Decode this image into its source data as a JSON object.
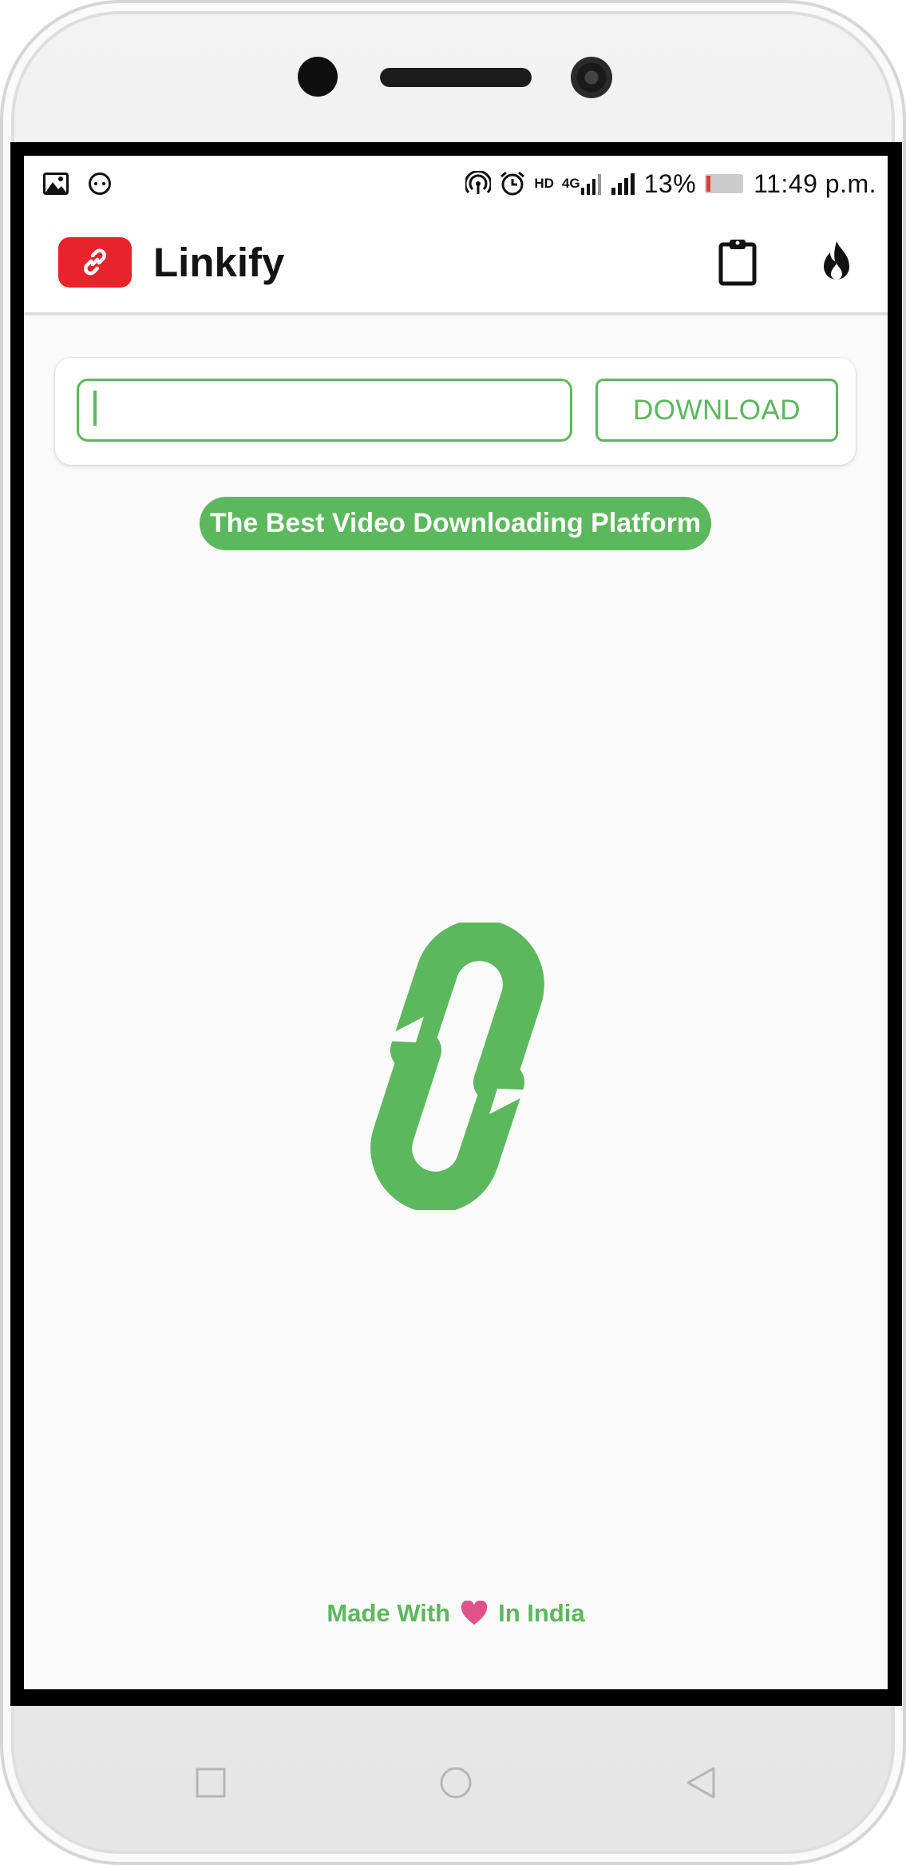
{
  "status_bar": {
    "battery_percent": "13%",
    "time": "11:49 p.m.",
    "network_type": "4G",
    "hd_badge": "HD",
    "icons": [
      "gallery-icon",
      "messenger-icon",
      "hotspot-icon",
      "alarm-icon",
      "hd-voice-icon",
      "signal-4g-icon",
      "signal-icon",
      "battery-icon"
    ]
  },
  "app_bar": {
    "title": "Linkify",
    "actions": [
      "clipboard-icon",
      "fire-icon"
    ]
  },
  "url_form": {
    "input_value": "",
    "download_label": "DOWNLOAD"
  },
  "tagline": "The Best Video Downloading Platform",
  "footer": {
    "prefix": "Made With",
    "suffix": "In India"
  },
  "nav_bar": {
    "keys": [
      "recents-key",
      "home-key",
      "back-key"
    ]
  },
  "colors": {
    "accent_green": "#5cb85c",
    "logo_red": "#e8232b",
    "heart_pink": "#e0528a"
  }
}
